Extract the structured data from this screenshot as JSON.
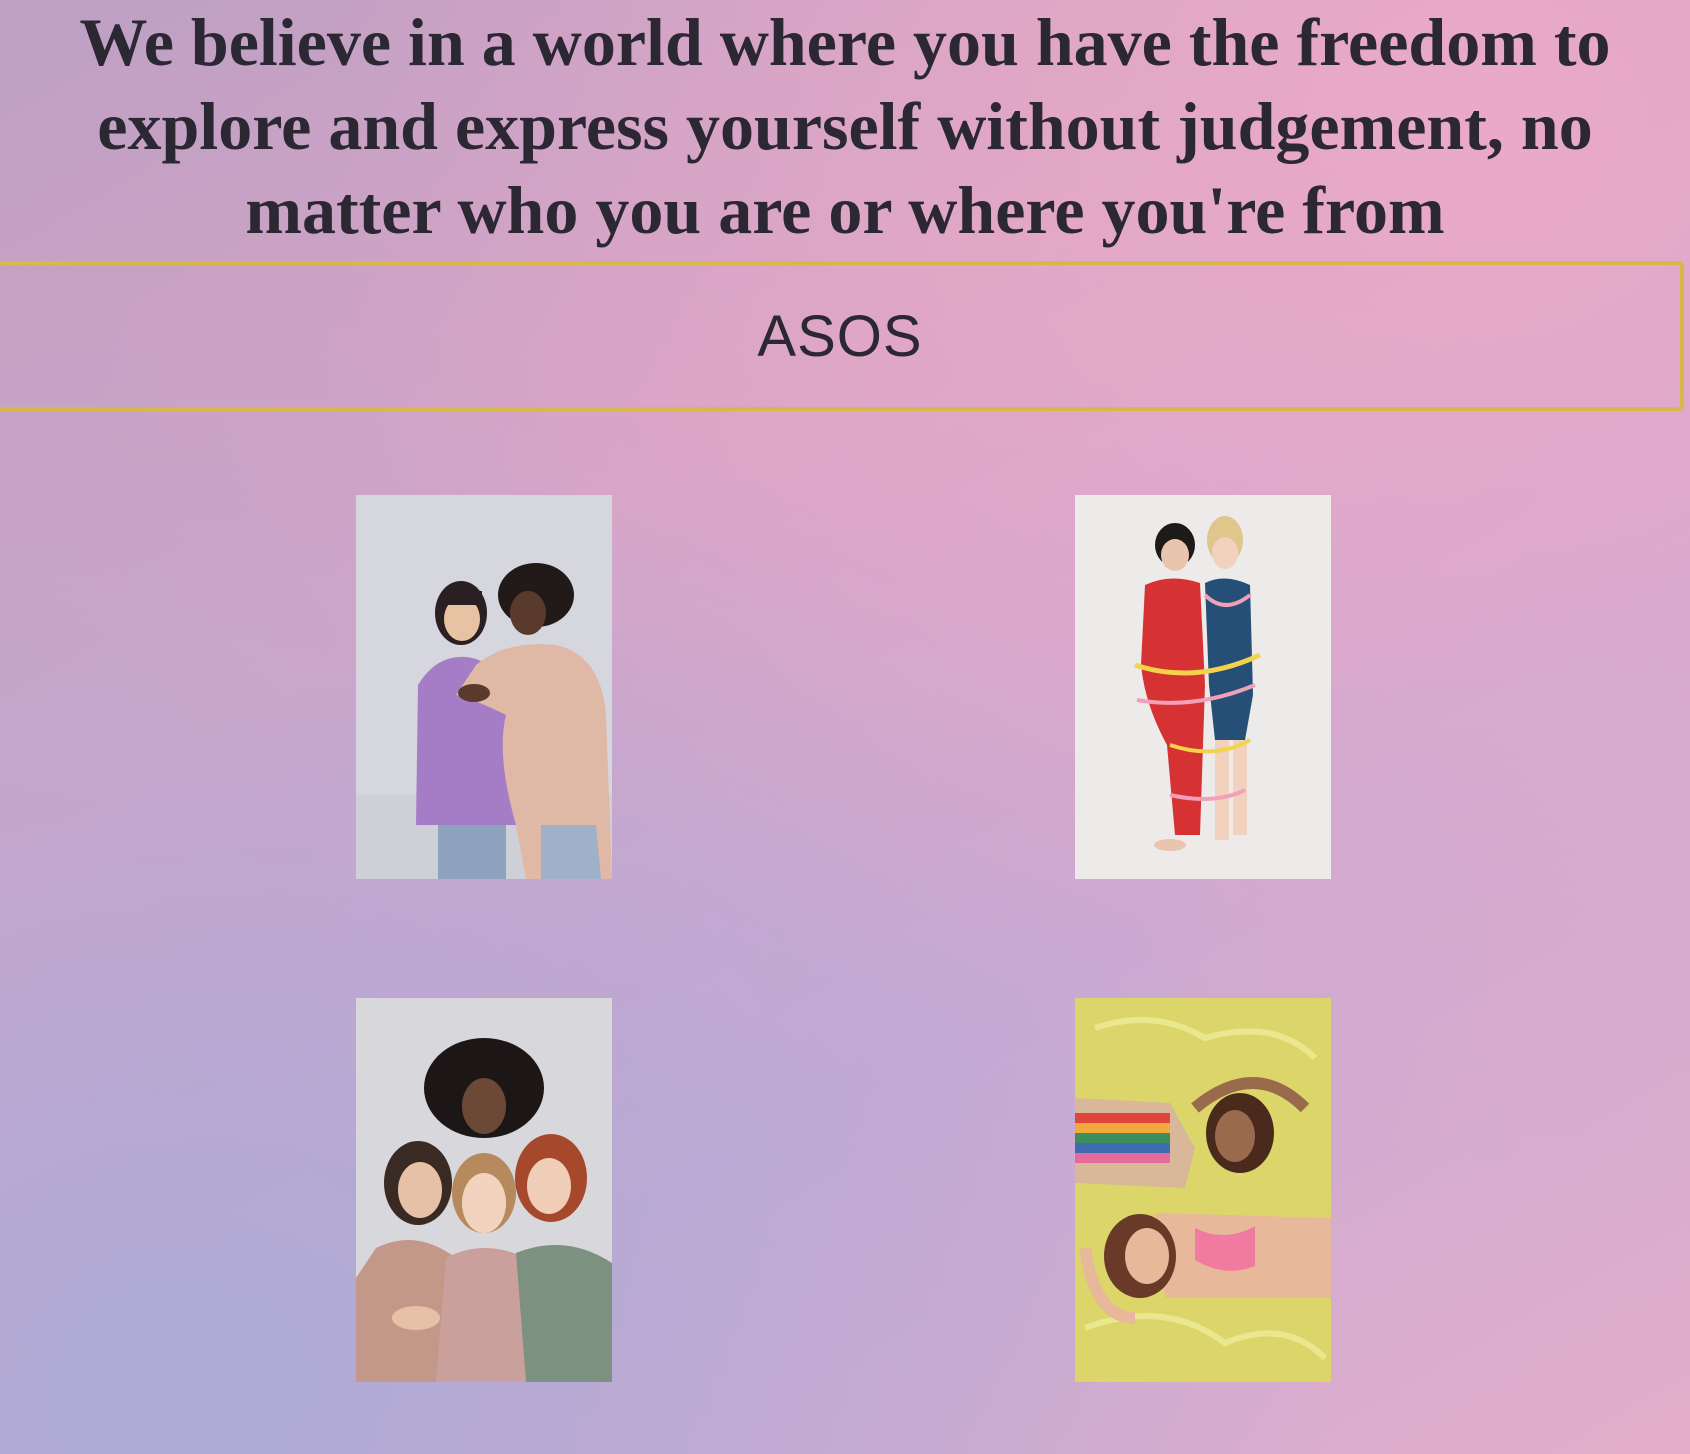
{
  "hero": {
    "statement": "We believe in a world where you have the freedom to explore and express yourself without judgement, no matter who you are or where you're from"
  },
  "brand": {
    "name": "ASOS",
    "border_color": "#d8b848"
  },
  "gallery": {
    "photos": [
      {
        "icon": "two-women-embracing-photo"
      },
      {
        "icon": "two-women-back-to-back-tied-with-ribbon-photo"
      },
      {
        "icon": "four-women-group-portrait-photo"
      },
      {
        "icon": "two-women-lying-on-yellow-plastic-photo"
      }
    ]
  },
  "colors": {
    "text": "#2b2733",
    "accent_border": "#d8b848",
    "background_pink": "#e3aecb",
    "background_lavender": "#bda0c4"
  }
}
